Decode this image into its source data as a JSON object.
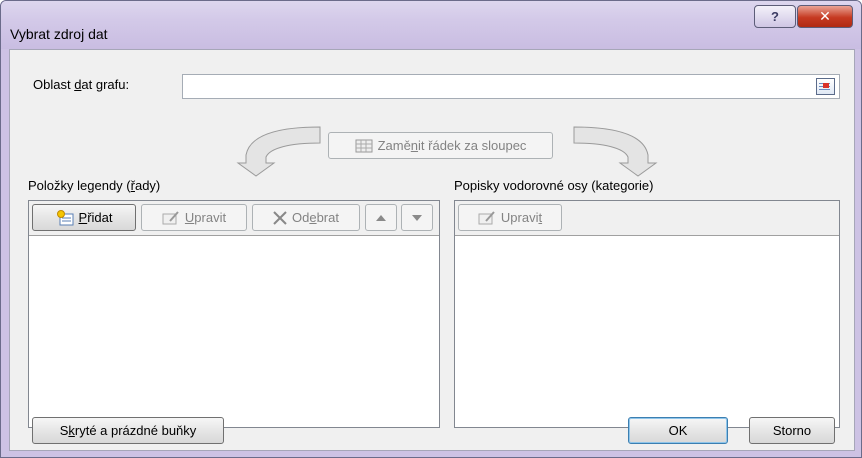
{
  "window": {
    "title": "Vybrat zdroj dat",
    "help_symbol": "?",
    "close_symbol": "✕"
  },
  "data_range": {
    "label_pre": "Oblast ",
    "label_key": "d",
    "label_post": "at grafu:",
    "value": ""
  },
  "switch_button": {
    "label_pre": "Zamě",
    "label_key": "n",
    "label_post": "it řádek za sloupec"
  },
  "legend_entries": {
    "label_pre": "Položky legendy (",
    "label_key": "ř",
    "label_post": "ady)",
    "add": {
      "key": "P",
      "rest": "řidat"
    },
    "edit": {
      "key": "U",
      "rest": "pravit"
    },
    "remove": {
      "pre": "Od",
      "key": "e",
      "post": "brat"
    },
    "items": []
  },
  "axis_labels": {
    "label_pre": "Popisky vodorovné osy (kate",
    "label_key": "g",
    "label_post": "orie)",
    "edit": {
      "pre": "Upravi",
      "key": "t"
    },
    "items": []
  },
  "footer": {
    "hidden_cells": {
      "pre": "S",
      "key": "k",
      "post": "ryté a prázdné buňky"
    },
    "ok": "OK",
    "cancel": "Storno"
  },
  "icons": [
    "help-icon",
    "close-icon",
    "range-picker-icon",
    "switch-row-column-icon",
    "add-series-icon",
    "edit-icon",
    "delete-icon",
    "move-up-icon",
    "move-down-icon",
    "curved-arrow-left-icon",
    "curved-arrow-right-icon"
  ]
}
